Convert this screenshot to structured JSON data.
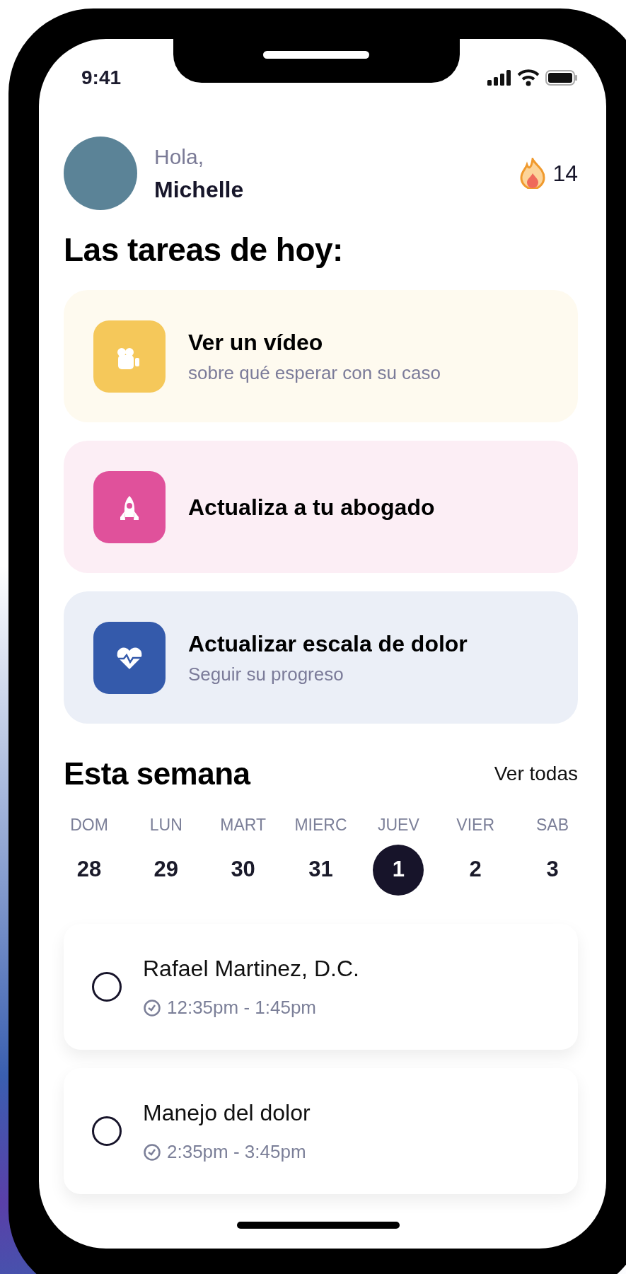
{
  "status_bar": {
    "time": "9:41"
  },
  "greeting": {
    "salutation": "Hola,",
    "name": "Michelle"
  },
  "streak": {
    "count": "14"
  },
  "tasks_title": "Las tareas de hoy:",
  "tasks": [
    {
      "kind": "video",
      "title": "Ver un vídeo",
      "subtitle": "sobre qué esperar con su caso",
      "color": "#f5c85a"
    },
    {
      "kind": "rocket",
      "title": "Actualiza a tu abogado",
      "color": "#e0519b"
    },
    {
      "kind": "heart",
      "title": "Actualizar escala de dolor",
      "subtitle": "Seguir su progreso",
      "color": "#345aab"
    }
  ],
  "week": {
    "title": "Esta semana",
    "link": "Ver todas",
    "days": [
      {
        "label": "DOM",
        "date": "28",
        "selected": false
      },
      {
        "label": "LUN",
        "date": "29",
        "selected": false
      },
      {
        "label": "MART",
        "date": "30",
        "selected": false
      },
      {
        "label": "MIERC",
        "date": "31",
        "selected": false
      },
      {
        "label": "JUEV",
        "date": "1",
        "selected": true
      },
      {
        "label": "VIER",
        "date": "2",
        "selected": false
      },
      {
        "label": "SAB",
        "date": "3",
        "selected": false
      }
    ]
  },
  "appointments": [
    {
      "title": "Rafael Martinez, D.C.",
      "time": "12:35pm - 1:45pm",
      "checked": false
    },
    {
      "title": "Manejo del dolor",
      "time": "2:35pm - 3:45pm",
      "checked": false
    }
  ]
}
